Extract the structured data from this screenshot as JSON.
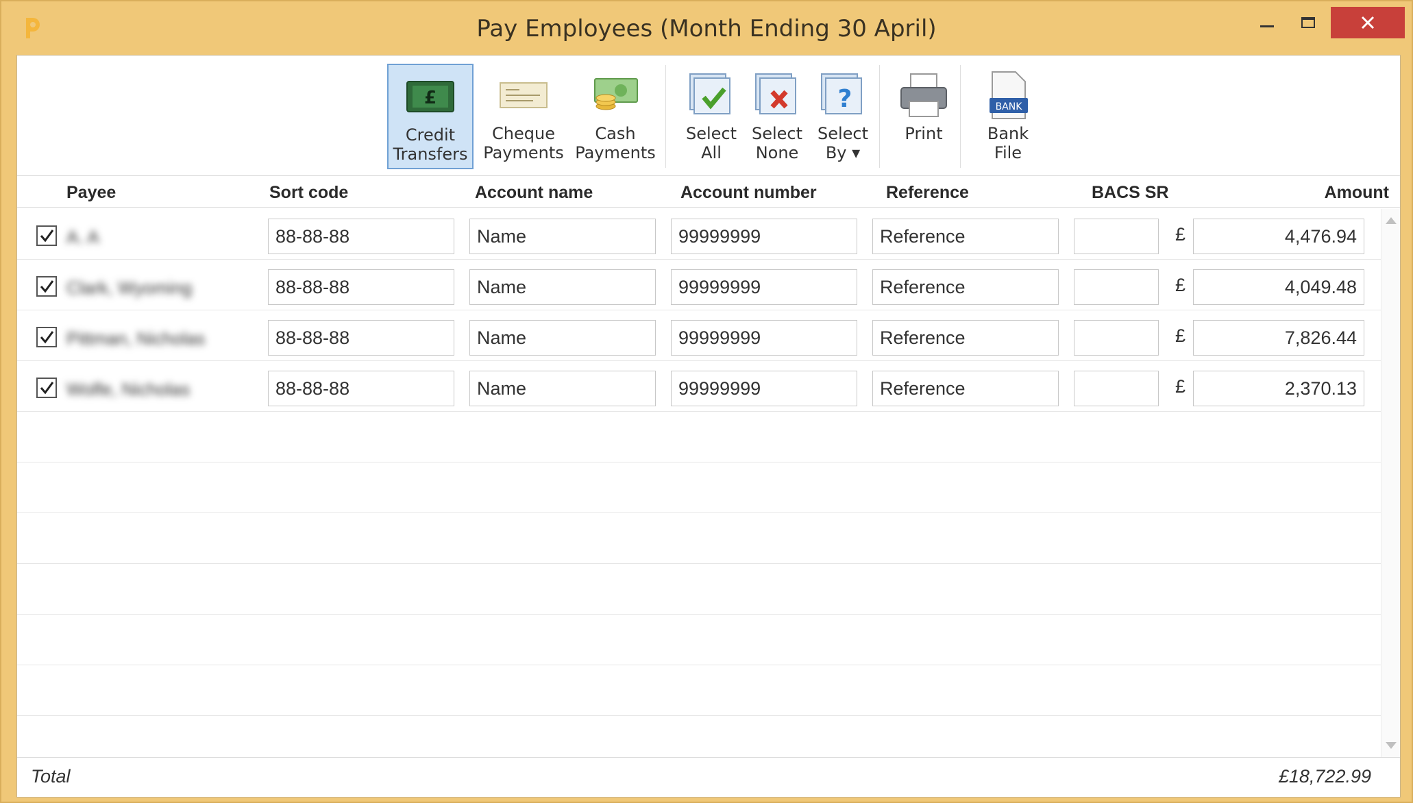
{
  "window": {
    "title": "Pay Employees (Month Ending 30 April)"
  },
  "toolbar": {
    "credit_transfers": [
      "Credit",
      "Transfers"
    ],
    "cheque_payments": [
      "Cheque",
      "Payments"
    ],
    "cash_payments": [
      "Cash",
      "Payments"
    ],
    "select_all": [
      "Select",
      "All"
    ],
    "select_none": [
      "Select",
      "None"
    ],
    "select_by": [
      "Select",
      "By ▾"
    ],
    "print": [
      "Print"
    ],
    "bank_file": [
      "Bank",
      "File"
    ],
    "bank_icon_text": "BANK"
  },
  "columns": {
    "payee": "Payee",
    "sort_code": "Sort code",
    "account_name": "Account name",
    "account_number": "Account number",
    "reference": "Reference",
    "bacs_sr": "BACS SR",
    "amount": "Amount"
  },
  "currency_symbol": "£",
  "rows": [
    {
      "checked": true,
      "payee": "A. A",
      "sort_code": "88-88-88",
      "account_name": "Name",
      "account_number": "99999999",
      "reference": "Reference",
      "bacs_sr": "",
      "amount": "4,476.94"
    },
    {
      "checked": true,
      "payee": "Clark, Wyoming",
      "sort_code": "88-88-88",
      "account_name": "Name",
      "account_number": "99999999",
      "reference": "Reference",
      "bacs_sr": "",
      "amount": "4,049.48"
    },
    {
      "checked": true,
      "payee": "Pittman, Nicholas",
      "sort_code": "88-88-88",
      "account_name": "Name",
      "account_number": "99999999",
      "reference": "Reference",
      "bacs_sr": "",
      "amount": "7,826.44"
    },
    {
      "checked": true,
      "payee": "Wolfe, Nicholas",
      "sort_code": "88-88-88",
      "account_name": "Name",
      "account_number": "99999999",
      "reference": "Reference",
      "bacs_sr": "",
      "amount": "2,370.13"
    }
  ],
  "footer": {
    "total_label": "Total",
    "total_value": "£18,722.99"
  },
  "colors": {
    "window_frame": "#f0c878",
    "close_button": "#c8403a",
    "active_tool": "#cfe3f6"
  }
}
